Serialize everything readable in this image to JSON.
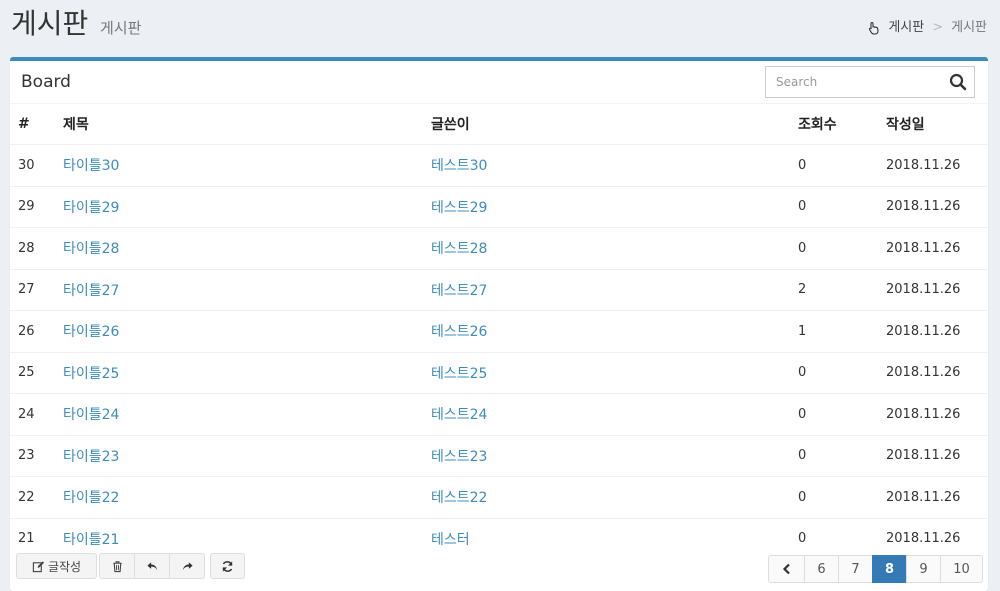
{
  "header": {
    "title": "게시판",
    "subtitle": "게시판",
    "breadcrumb": [
      {
        "label": "게시판",
        "icon": "hand-pointer-icon"
      },
      {
        "label": "게시판"
      }
    ],
    "breadcrumb_separator": ">"
  },
  "box": {
    "title": "Board",
    "accent_color": "#3c8dbc",
    "search": {
      "placeholder": "Search",
      "value": "",
      "icon": "search-icon"
    }
  },
  "table": {
    "columns": [
      "#",
      "제목",
      "글쓴이",
      "조회수",
      "작성일"
    ],
    "rows": [
      {
        "num": "30",
        "title": "타이틀30",
        "writer": "테스트30",
        "views": "0",
        "date": "2018.11.26"
      },
      {
        "num": "29",
        "title": "타이틀29",
        "writer": "테스트29",
        "views": "0",
        "date": "2018.11.26"
      },
      {
        "num": "28",
        "title": "타이틀28",
        "writer": "테스트28",
        "views": "0",
        "date": "2018.11.26"
      },
      {
        "num": "27",
        "title": "타이틀27",
        "writer": "테스트27",
        "views": "2",
        "date": "2018.11.26"
      },
      {
        "num": "26",
        "title": "타이틀26",
        "writer": "테스트26",
        "views": "1",
        "date": "2018.11.26"
      },
      {
        "num": "25",
        "title": "타이틀25",
        "writer": "테스트25",
        "views": "0",
        "date": "2018.11.26"
      },
      {
        "num": "24",
        "title": "타이틀24",
        "writer": "테스트24",
        "views": "0",
        "date": "2018.11.26"
      },
      {
        "num": "23",
        "title": "타이틀23",
        "writer": "테스트23",
        "views": "0",
        "date": "2018.11.26"
      },
      {
        "num": "22",
        "title": "타이틀22",
        "writer": "테스트22",
        "views": "0",
        "date": "2018.11.26"
      },
      {
        "num": "21",
        "title": "타이틀21",
        "writer": "테스터",
        "views": "0",
        "date": "2018.11.26"
      }
    ]
  },
  "footer": {
    "write_label": "글작성",
    "write_icon": "edit-icon",
    "group_icons": [
      "trash-icon",
      "reply-icon",
      "share-icon"
    ],
    "refresh_icon": "refresh-icon",
    "pagination": {
      "prev_icon": "chevron-left-icon",
      "pages": [
        "6",
        "7",
        "8",
        "9",
        "10"
      ],
      "current": "8",
      "active_color": "#337ab7"
    }
  }
}
